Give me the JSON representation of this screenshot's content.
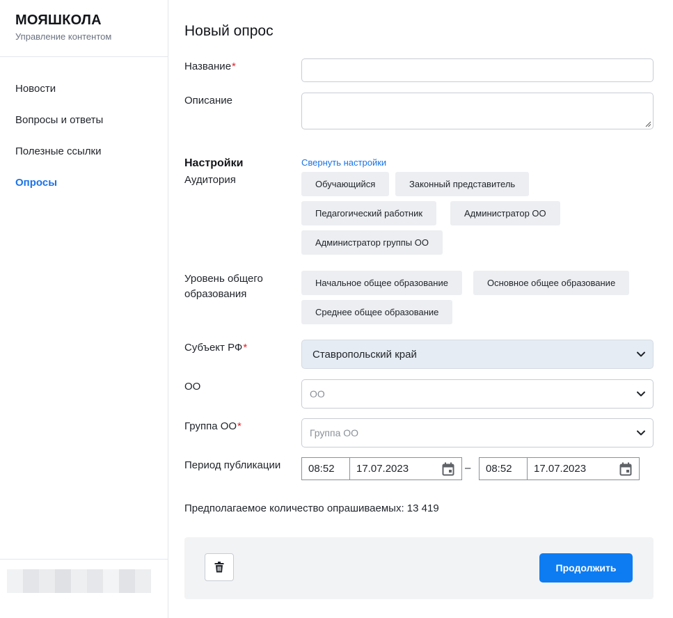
{
  "sidebar": {
    "logo": "МОЯШКОЛА",
    "subtitle": "Управление контентом",
    "items": [
      {
        "label": "Новости"
      },
      {
        "label": "Вопросы и ответы"
      },
      {
        "label": "Полезные ссылки"
      },
      {
        "label": "Опросы",
        "active": true
      }
    ]
  },
  "form": {
    "title": "Новый опрос",
    "name_label": "Название",
    "description_label": "Описание",
    "settings_title": "Настройки",
    "collapse_link": "Свернуть настройки",
    "audience_label": "Аудитория",
    "audience_options": [
      "Обучающийся",
      "Законный представитель",
      "Педагогический работник",
      "Администратор ОО",
      "Администратор группы ОО"
    ],
    "level_label": "Уровень общего образования",
    "level_options": [
      "Начальное общее образование",
      "Основное общее образование",
      "Среднее общее образование"
    ],
    "region_label": "Субъект РФ",
    "region_value": "Ставропольский край",
    "org_label": "ОО",
    "org_placeholder": "ОО",
    "group_label": "Группа ОО",
    "group_placeholder": "Группа ОО",
    "period_label": "Период публикации",
    "period_start_time": "08:52",
    "period_start_date": "17.07.2023",
    "period_end_time": "08:52",
    "period_end_date": "17.07.2023",
    "period_separator": "–",
    "required_mark": "*",
    "estimate_text": "Предполагаемое количество опрашиваемых: 13 419"
  },
  "footer": {
    "continue_label": "Продолжить"
  },
  "colors": {
    "accent": "#1a73e8",
    "primary_button": "#0d7cf2",
    "required": "#e0212b",
    "chip_bg": "#eceef1",
    "filled_select_bg": "#e6ecf3"
  },
  "icons": [
    "chevron-down-icon",
    "calendar-icon",
    "trash-icon",
    "resize-grip-icon"
  ]
}
